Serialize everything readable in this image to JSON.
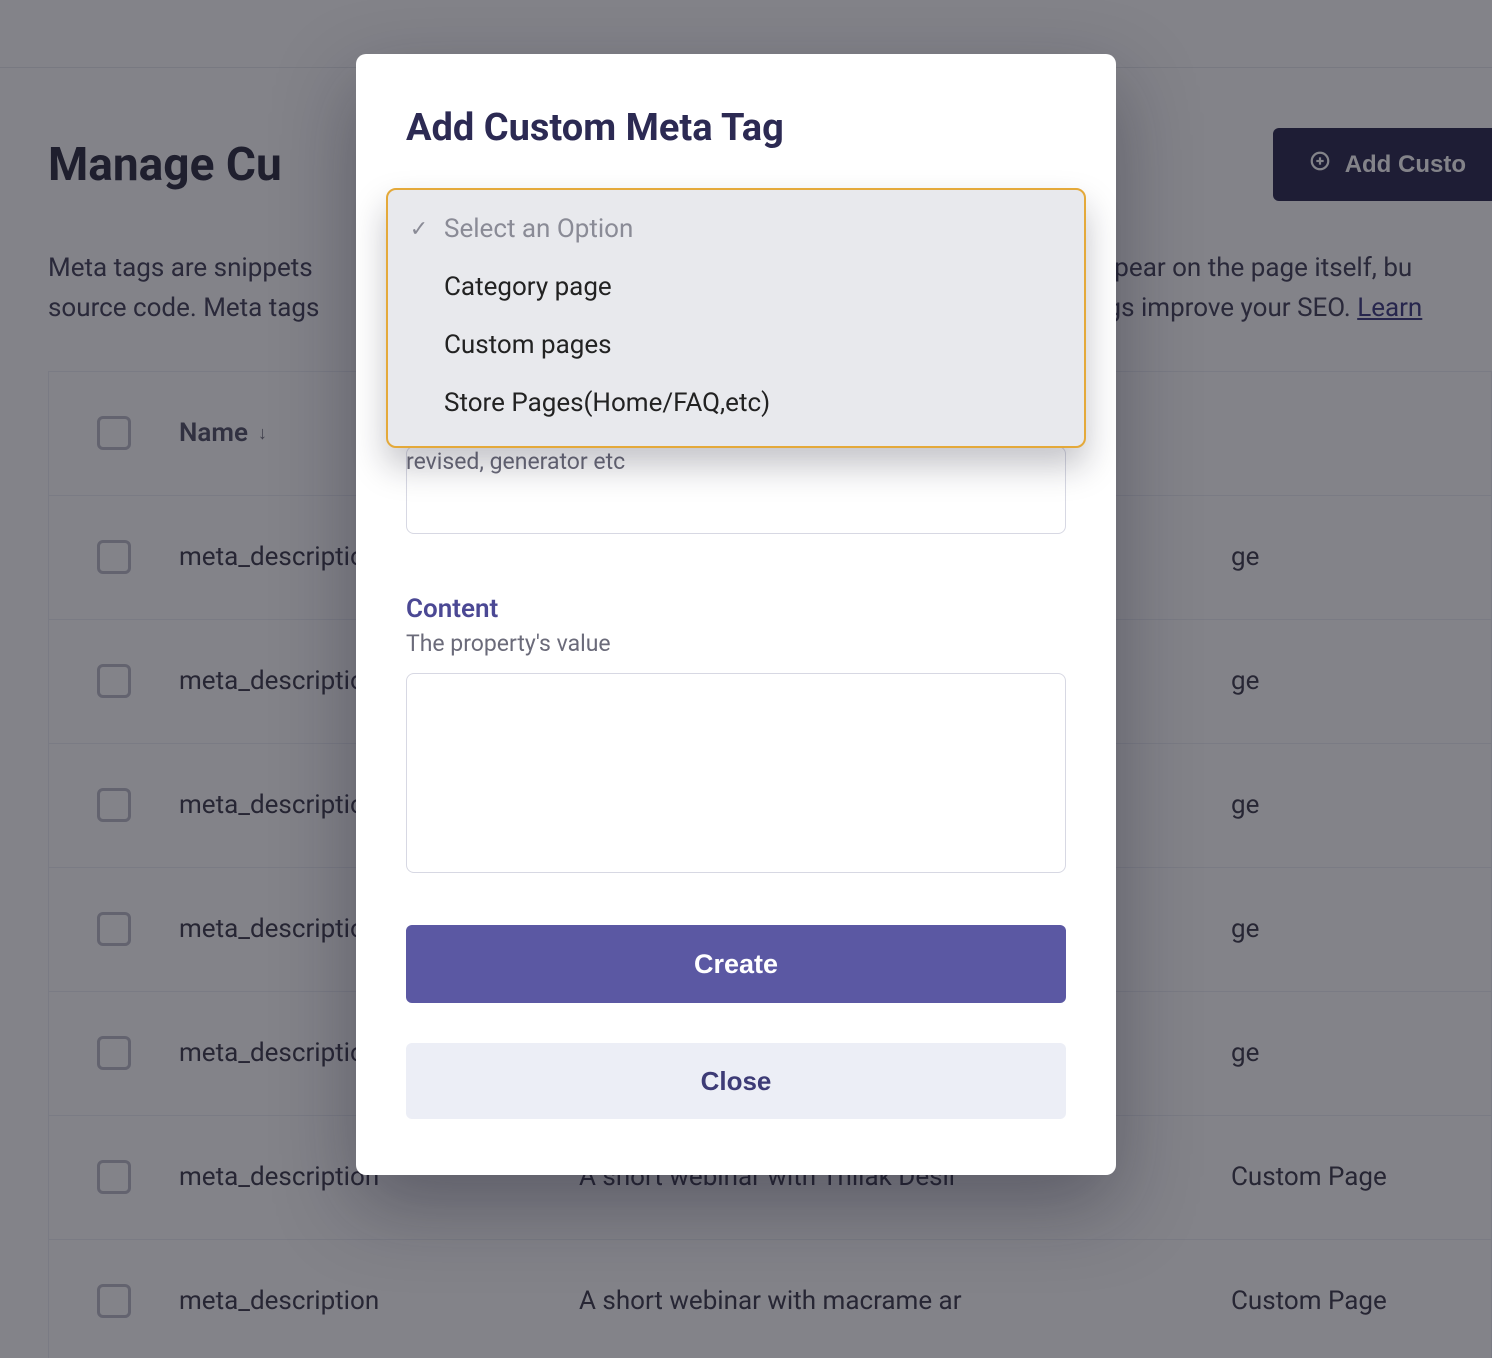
{
  "header": {
    "page_title": "Manage Cu",
    "add_button_label": "Add Custo"
  },
  "intro": {
    "line1_left": "Meta tags are snippets ",
    "line1_right": " appear on the page itself, bu",
    "line2_left": "source code. Meta tags ",
    "line2_right": "ags improve your SEO. ",
    "learn": "Learn"
  },
  "table": {
    "columns": {
      "name": "Name"
    },
    "sort_arrow": "↓",
    "rows": [
      {
        "name": "meta_descriptio",
        "content": "",
        "type": "ge"
      },
      {
        "name": "meta_descriptio",
        "content": "",
        "type": "ge"
      },
      {
        "name": "meta_descriptio",
        "content": "",
        "type": "ge"
      },
      {
        "name": "meta_descriptio",
        "content": "",
        "type": "ge"
      },
      {
        "name": "meta_descriptio",
        "content": "",
        "type": "ge"
      },
      {
        "name": "meta_description",
        "content": "A short webinar with Thilak Desir",
        "type": "Custom Page"
      },
      {
        "name": "meta_description",
        "content": "A short webinar with macrame ar",
        "type": "Custom Page"
      }
    ]
  },
  "modal": {
    "title": "Add Custom Meta Tag",
    "name_help_fragment": "revised, generator etc",
    "content_label": "Content",
    "content_help": "The property's value",
    "name_value": "",
    "content_value": "",
    "create_label": "Create",
    "close_label": "Close"
  },
  "dropdown": {
    "placeholder": "Select an Option",
    "options": [
      "Category page",
      "Custom pages",
      "Store Pages(Home/FAQ,etc)"
    ]
  }
}
